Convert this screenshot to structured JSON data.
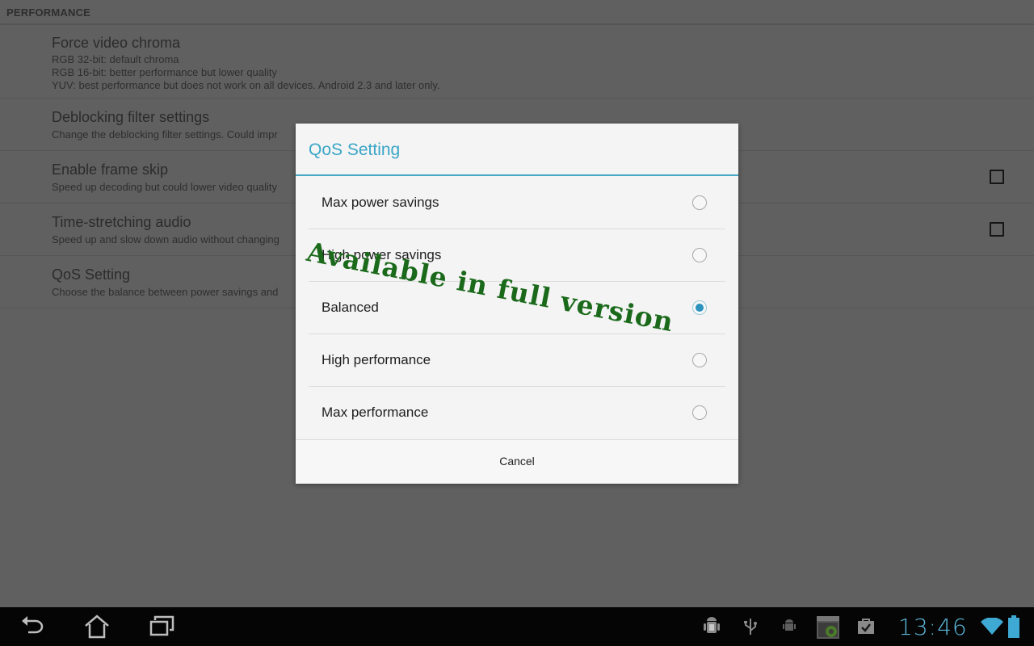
{
  "settings": {
    "category": "PERFORMANCE",
    "preferences": [
      {
        "title": "Force video chroma",
        "summary": "RGB 32-bit: default chroma\nRGB 16-bit: better performance but lower quality\nYUV: best performance but does not work on all devices. Android 2.3 and later only."
      },
      {
        "title": "Deblocking filter settings",
        "summary": "Change the deblocking filter settings. Could impr"
      },
      {
        "title": "Enable frame skip",
        "summary": "Speed up decoding but could lower video quality",
        "checked": false
      },
      {
        "title": "Time-stretching audio",
        "summary": "Speed up and slow down audio without changing",
        "checked": false
      },
      {
        "title": "QoS Setting",
        "summary": "Choose the balance between power savings and"
      }
    ]
  },
  "dialog": {
    "title": "QoS Setting",
    "options": [
      {
        "label": "Max power savings",
        "selected": false
      },
      {
        "label": "High power savings",
        "selected": false
      },
      {
        "label": "Balanced",
        "selected": true
      },
      {
        "label": "High performance",
        "selected": false
      },
      {
        "label": "Max performance",
        "selected": false
      }
    ],
    "cancel_label": "Cancel"
  },
  "watermark": "Available in full version",
  "navbar": {
    "buttons": [
      "back-icon",
      "home-icon",
      "recent-apps-icon"
    ],
    "status_icons": [
      "android-debug-icon",
      "usb-icon",
      "android-notification-icon",
      "screenshot-app-icon",
      "shopping-bag-check-icon"
    ],
    "time": "13:46",
    "wifi": "wifi-icon",
    "battery": "battery-icon"
  },
  "colors": {
    "accent": "#3aa6c7",
    "watermark": "#1b6a1b",
    "radio_selected": "#2b93bd"
  }
}
